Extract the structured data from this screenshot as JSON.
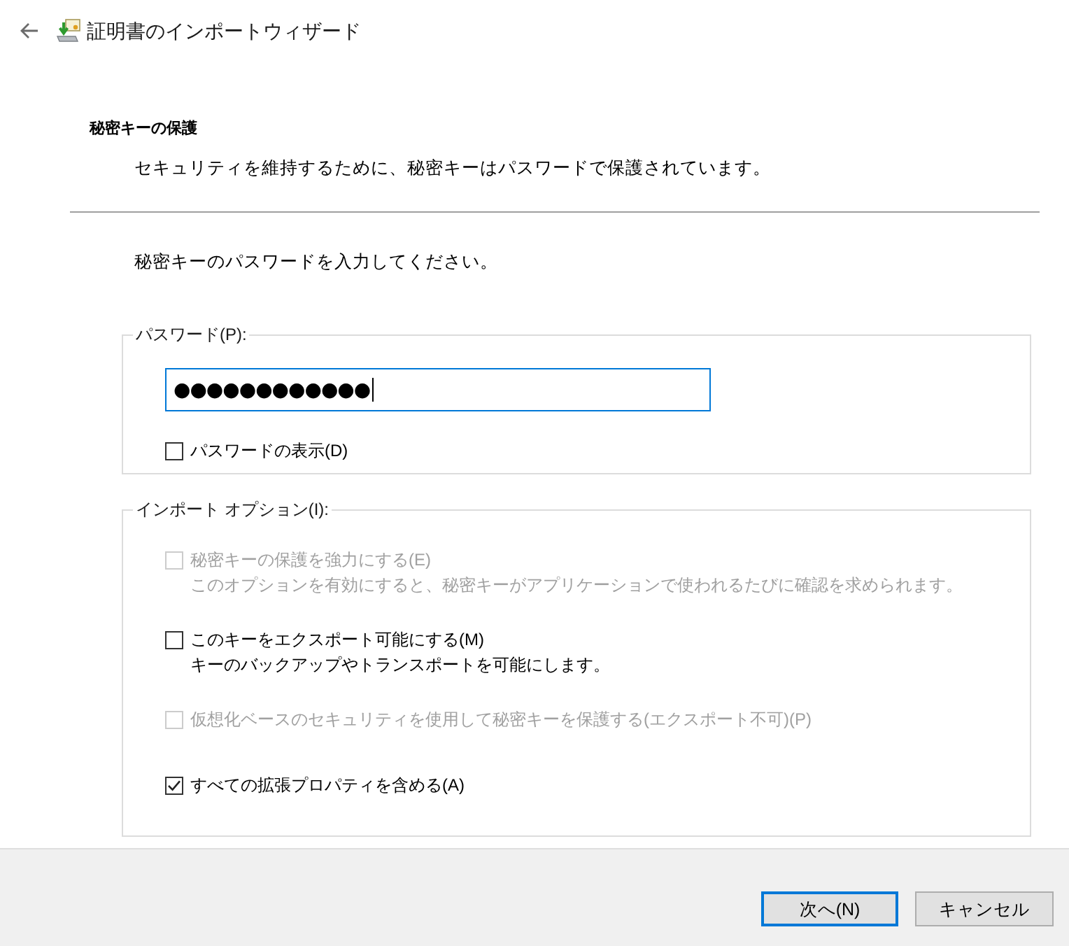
{
  "window": {
    "title": "証明書のインポートウィザード"
  },
  "page_header": {
    "title": "秘密キーの保護",
    "subtitle": "セキュリティを維持するために、秘密キーはパスワードで保護されています。"
  },
  "prompt": "秘密キーのパスワードを入力してください。",
  "password_group": {
    "legend": "パスワード(P):",
    "password_field": {
      "value": "●●●●●●●●●●●●",
      "focused": true
    },
    "show_password": {
      "label": "パスワードの表示(D)",
      "checked": false
    }
  },
  "import_options": {
    "legend": "インポート オプション(I):",
    "options": [
      {
        "label": "秘密キーの保護を強力にする(E)",
        "description": "このオプションを有効にすると、秘密キーがアプリケーションで使われるたびに確認を求められます。",
        "checked": false,
        "disabled": true
      },
      {
        "label": "このキーをエクスポート可能にする(M)",
        "description": "キーのバックアップやトランスポートを可能にします。",
        "checked": false,
        "disabled": false
      },
      {
        "label": "仮想化ベースのセキュリティを使用して秘密キーを保護する(エクスポート不可)(P)",
        "checked": false,
        "disabled": true
      },
      {
        "label": "すべての拡張プロパティを含める(A)",
        "checked": true,
        "disabled": false
      }
    ]
  },
  "buttons": [
    {
      "label": "次へ(N)",
      "default": true
    },
    {
      "label": "キャンセル",
      "default": false
    }
  ]
}
